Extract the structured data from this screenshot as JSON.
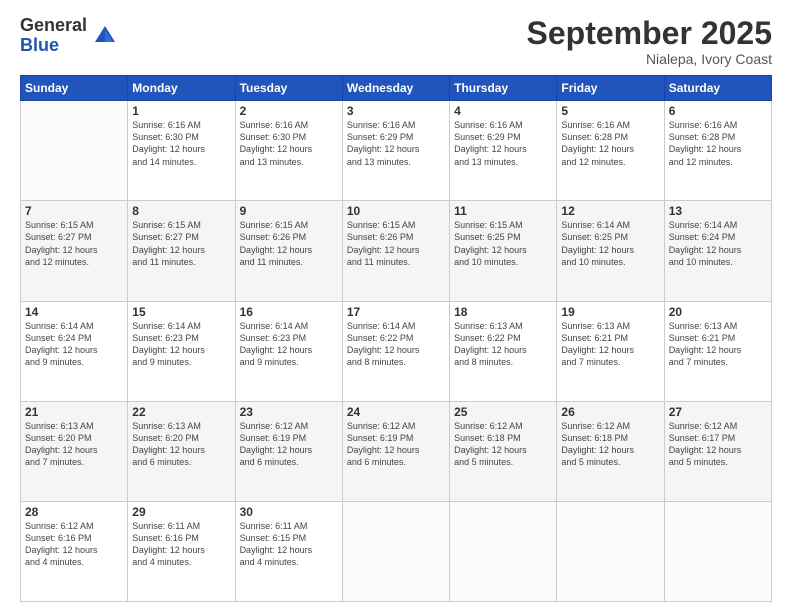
{
  "logo": {
    "general": "General",
    "blue": "Blue"
  },
  "header": {
    "month": "September 2025",
    "location": "Nialepa, Ivory Coast"
  },
  "weekdays": [
    "Sunday",
    "Monday",
    "Tuesday",
    "Wednesday",
    "Thursday",
    "Friday",
    "Saturday"
  ],
  "weeks": [
    [
      {
        "day": "",
        "info": ""
      },
      {
        "day": "1",
        "info": "Sunrise: 6:16 AM\nSunset: 6:30 PM\nDaylight: 12 hours\nand 14 minutes."
      },
      {
        "day": "2",
        "info": "Sunrise: 6:16 AM\nSunset: 6:30 PM\nDaylight: 12 hours\nand 13 minutes."
      },
      {
        "day": "3",
        "info": "Sunrise: 6:16 AM\nSunset: 6:29 PM\nDaylight: 12 hours\nand 13 minutes."
      },
      {
        "day": "4",
        "info": "Sunrise: 6:16 AM\nSunset: 6:29 PM\nDaylight: 12 hours\nand 13 minutes."
      },
      {
        "day": "5",
        "info": "Sunrise: 6:16 AM\nSunset: 6:28 PM\nDaylight: 12 hours\nand 12 minutes."
      },
      {
        "day": "6",
        "info": "Sunrise: 6:16 AM\nSunset: 6:28 PM\nDaylight: 12 hours\nand 12 minutes."
      }
    ],
    [
      {
        "day": "7",
        "info": "Sunrise: 6:15 AM\nSunset: 6:27 PM\nDaylight: 12 hours\nand 12 minutes."
      },
      {
        "day": "8",
        "info": "Sunrise: 6:15 AM\nSunset: 6:27 PM\nDaylight: 12 hours\nand 11 minutes."
      },
      {
        "day": "9",
        "info": "Sunrise: 6:15 AM\nSunset: 6:26 PM\nDaylight: 12 hours\nand 11 minutes."
      },
      {
        "day": "10",
        "info": "Sunrise: 6:15 AM\nSunset: 6:26 PM\nDaylight: 12 hours\nand 11 minutes."
      },
      {
        "day": "11",
        "info": "Sunrise: 6:15 AM\nSunset: 6:25 PM\nDaylight: 12 hours\nand 10 minutes."
      },
      {
        "day": "12",
        "info": "Sunrise: 6:14 AM\nSunset: 6:25 PM\nDaylight: 12 hours\nand 10 minutes."
      },
      {
        "day": "13",
        "info": "Sunrise: 6:14 AM\nSunset: 6:24 PM\nDaylight: 12 hours\nand 10 minutes."
      }
    ],
    [
      {
        "day": "14",
        "info": "Sunrise: 6:14 AM\nSunset: 6:24 PM\nDaylight: 12 hours\nand 9 minutes."
      },
      {
        "day": "15",
        "info": "Sunrise: 6:14 AM\nSunset: 6:23 PM\nDaylight: 12 hours\nand 9 minutes."
      },
      {
        "day": "16",
        "info": "Sunrise: 6:14 AM\nSunset: 6:23 PM\nDaylight: 12 hours\nand 9 minutes."
      },
      {
        "day": "17",
        "info": "Sunrise: 6:14 AM\nSunset: 6:22 PM\nDaylight: 12 hours\nand 8 minutes."
      },
      {
        "day": "18",
        "info": "Sunrise: 6:13 AM\nSunset: 6:22 PM\nDaylight: 12 hours\nand 8 minutes."
      },
      {
        "day": "19",
        "info": "Sunrise: 6:13 AM\nSunset: 6:21 PM\nDaylight: 12 hours\nand 7 minutes."
      },
      {
        "day": "20",
        "info": "Sunrise: 6:13 AM\nSunset: 6:21 PM\nDaylight: 12 hours\nand 7 minutes."
      }
    ],
    [
      {
        "day": "21",
        "info": "Sunrise: 6:13 AM\nSunset: 6:20 PM\nDaylight: 12 hours\nand 7 minutes."
      },
      {
        "day": "22",
        "info": "Sunrise: 6:13 AM\nSunset: 6:20 PM\nDaylight: 12 hours\nand 6 minutes."
      },
      {
        "day": "23",
        "info": "Sunrise: 6:12 AM\nSunset: 6:19 PM\nDaylight: 12 hours\nand 6 minutes."
      },
      {
        "day": "24",
        "info": "Sunrise: 6:12 AM\nSunset: 6:19 PM\nDaylight: 12 hours\nand 6 minutes."
      },
      {
        "day": "25",
        "info": "Sunrise: 6:12 AM\nSunset: 6:18 PM\nDaylight: 12 hours\nand 5 minutes."
      },
      {
        "day": "26",
        "info": "Sunrise: 6:12 AM\nSunset: 6:18 PM\nDaylight: 12 hours\nand 5 minutes."
      },
      {
        "day": "27",
        "info": "Sunrise: 6:12 AM\nSunset: 6:17 PM\nDaylight: 12 hours\nand 5 minutes."
      }
    ],
    [
      {
        "day": "28",
        "info": "Sunrise: 6:12 AM\nSunset: 6:16 PM\nDaylight: 12 hours\nand 4 minutes."
      },
      {
        "day": "29",
        "info": "Sunrise: 6:11 AM\nSunset: 6:16 PM\nDaylight: 12 hours\nand 4 minutes."
      },
      {
        "day": "30",
        "info": "Sunrise: 6:11 AM\nSunset: 6:15 PM\nDaylight: 12 hours\nand 4 minutes."
      },
      {
        "day": "",
        "info": ""
      },
      {
        "day": "",
        "info": ""
      },
      {
        "day": "",
        "info": ""
      },
      {
        "day": "",
        "info": ""
      }
    ]
  ]
}
